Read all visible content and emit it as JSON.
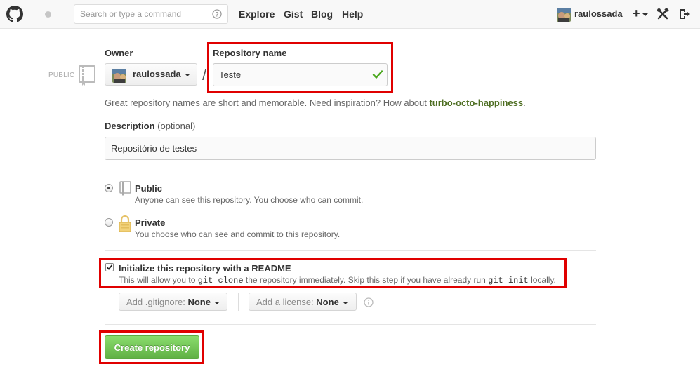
{
  "header": {
    "search_placeholder": "Search or type a command",
    "nav": [
      "Explore",
      "Gist",
      "Blog",
      "Help"
    ],
    "username": "raulossada",
    "icons": [
      "github-logo-icon",
      "notification-icon",
      "help-icon",
      "plus-icon",
      "tools-icon",
      "sign-out-icon"
    ]
  },
  "form": {
    "visibility_tag": "PUBLIC",
    "owner_label": "Owner",
    "owner_value": "raulossada",
    "slash": "/",
    "repo_name_label": "Repository name",
    "repo_name_value": "Teste",
    "hint_prefix": "Great repository names are short and memorable. Need inspiration? How about ",
    "hint_suggestion": "turbo-octo-happiness",
    "hint_suffix": ".",
    "description_label": "Description",
    "description_optional": "(optional)",
    "description_value": "Repositório de testes",
    "public_title": "Public",
    "public_desc": "Anyone can see this repository. You choose who can commit.",
    "private_title": "Private",
    "private_desc": "You choose who can see and commit to this repository.",
    "readme_title": "Initialize this repository with a README",
    "readme_desc_1": "This will allow you to ",
    "readme_code_1": "git clone",
    "readme_desc_2": " the repository immediately. Skip this step if you have already run ",
    "readme_code_2": "git init",
    "readme_desc_3": " locally.",
    "gitignore_label": "Add .gitignore:",
    "gitignore_value": "None",
    "license_label": "Add a license:",
    "license_value": "None",
    "create_button": "Create repository",
    "selected_visibility": "public",
    "readme_checked": true
  },
  "colors": {
    "highlight": "#e00000",
    "create_button": "#60b044",
    "suggestion": "#4e6e22",
    "check": "#4ba81e"
  }
}
